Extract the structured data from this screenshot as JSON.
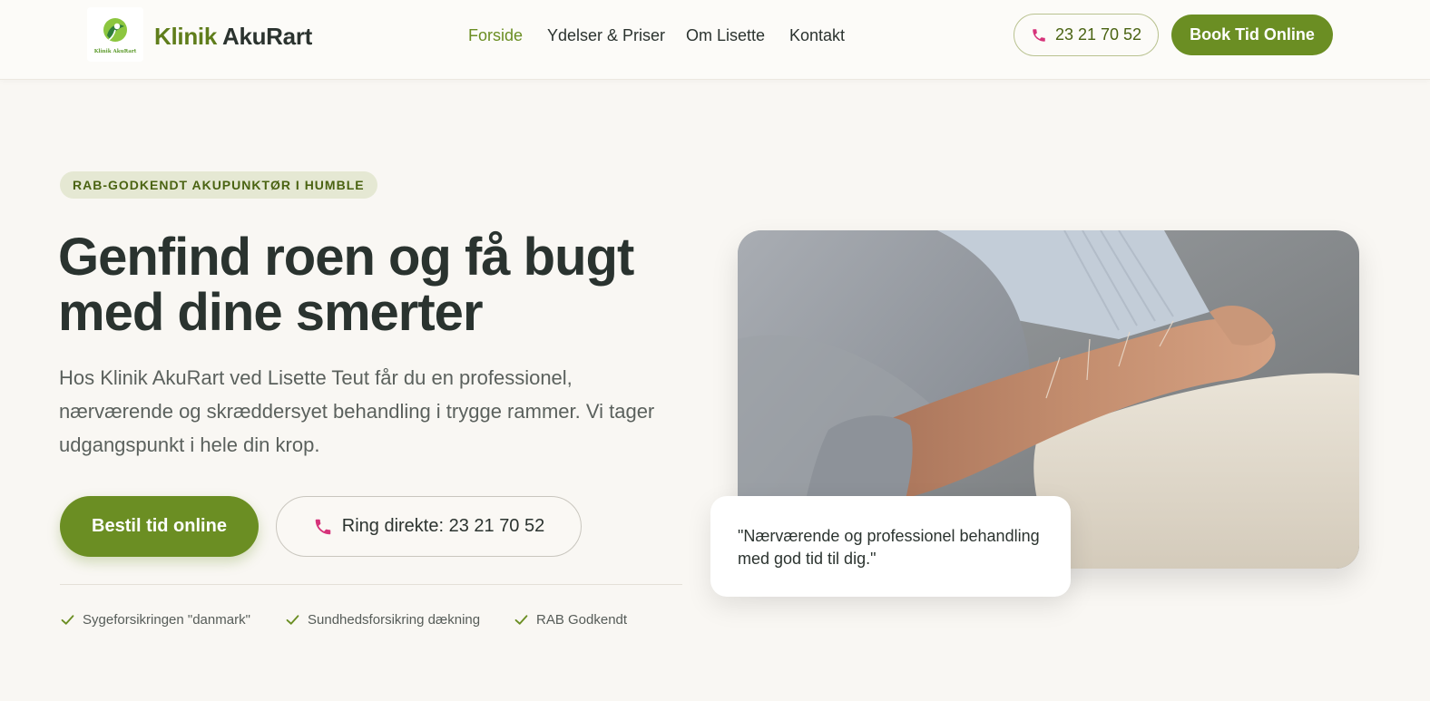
{
  "header": {
    "logo_small_text": "Klinik AkuRart",
    "brand_part1": "Klinik",
    "brand_part2": "AkuRart",
    "nav": [
      {
        "label": "Forside",
        "active": true
      },
      {
        "label": "Ydelser & Priser",
        "active": false
      },
      {
        "label": "Om Lisette",
        "active": false
      },
      {
        "label": "Kontakt",
        "active": false
      }
    ],
    "phone_icon": "phone-icon",
    "phone": "23 21 70 52",
    "book_label": "Book Tid Online"
  },
  "hero": {
    "badge": "RAB-GODKENDT AKUPUNKTØR I HUMBLE",
    "headline": "Genfind roen og få bugt med dine smerter",
    "lead": "Hos Klinik AkuRart ved Lisette Teut får du en professionel, nærværende og skræddersyet behandling i trygge rammer. Vi tager udgangspunkt i hele din krop.",
    "primary_button": "Bestil tid online",
    "secondary_button": "Ring direkte: 23 21 70 52",
    "check_icon": "check-icon",
    "checks": [
      "Sygeforsikringen \"danmark\"",
      "Sundhedsforsikring dækning",
      "RAB Godkendt"
    ],
    "quote": "\"Nærværende og professionel behandling med god tid til dig.\""
  },
  "colors": {
    "accent": "#6b8e23",
    "accent_dark": "#4a6312",
    "phone_icon": "#d6337a",
    "background": "#f9f7f3",
    "text": "#2b332f"
  }
}
